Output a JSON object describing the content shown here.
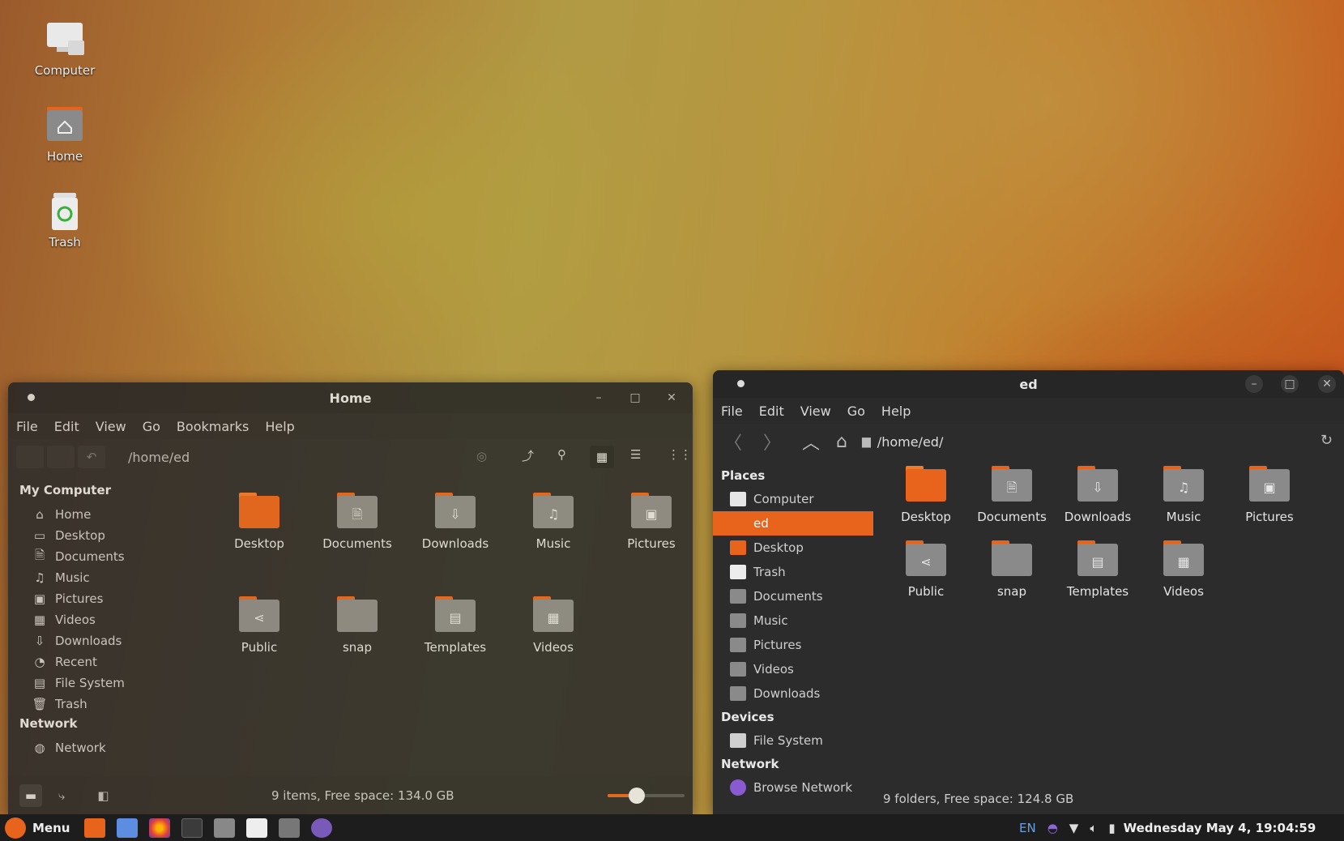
{
  "desktop": {
    "icons": [
      {
        "label": "Computer"
      },
      {
        "label": "Home"
      },
      {
        "label": "Trash"
      }
    ]
  },
  "left_window": {
    "title": "Home",
    "menu": [
      "File",
      "Edit",
      "View",
      "Go",
      "Bookmarks",
      "Help"
    ],
    "path": "/home/ed",
    "sidebar": {
      "section1": "My Computer",
      "items": [
        "Home",
        "Desktop",
        "Documents",
        "Music",
        "Pictures",
        "Videos",
        "Downloads",
        "Recent",
        "File System",
        "Trash"
      ],
      "section2": "Network",
      "network_items": [
        "Network"
      ]
    },
    "files": [
      "Desktop",
      "Documents",
      "Downloads",
      "Music",
      "Pictures",
      "Public",
      "snap",
      "Templates",
      "Videos"
    ],
    "status": "9 items, Free space: 134.0 GB"
  },
  "right_window": {
    "title": "ed",
    "menu": [
      "File",
      "Edit",
      "View",
      "Go",
      "Help"
    ],
    "path": "/home/ed/",
    "places_title": "Places",
    "places": [
      "Computer",
      "ed",
      "Desktop",
      "Trash",
      "Documents",
      "Music",
      "Pictures",
      "Videos",
      "Downloads"
    ],
    "devices_title": "Devices",
    "devices": [
      "File System"
    ],
    "network_title": "Network",
    "network": [
      "Browse Network"
    ],
    "files": [
      "Desktop",
      "Documents",
      "Downloads",
      "Music",
      "Pictures",
      "Public",
      "snap",
      "Templates",
      "Videos"
    ],
    "status": "9 folders, Free space: 124.8 GB"
  },
  "taskbar": {
    "menu_label": "Menu",
    "lang": "EN",
    "clock": "Wednesday May  4, 19:04:59"
  },
  "colors": {
    "accent": "#e8641c",
    "folder": "#8a8a8a",
    "panel": "#2c2c2c"
  }
}
